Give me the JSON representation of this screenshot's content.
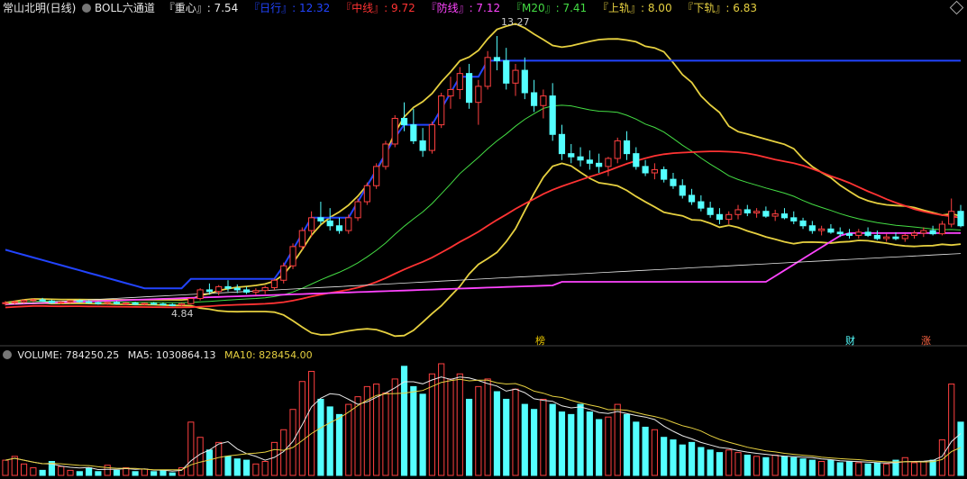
{
  "header": {
    "stock_title": "常山北明(日线)",
    "indicator": "BOLL六通道",
    "zhongxin": "『重心』: 7.54",
    "rixing": "『日行』: 12.32",
    "zhongxian": "『中线』: 9.72",
    "fangxian": "『防线』: 7.12",
    "m20": "『M20』: 7.41",
    "shanggui": "『上轨』: 8.00",
    "xiagui": "『下轨』: 6.83"
  },
  "markers": {
    "bang": "榜",
    "cai": "财",
    "zhang": "涨"
  },
  "volume_header": {
    "volume": "VOLUME: 784250.25",
    "ma5": "MA5: 1030864.13",
    "ma10": "MA10: 828454.00"
  },
  "colors": {
    "zhongxin": "#e8e8e8",
    "rixing": "#2244ff",
    "zhongxian": "#ff3333",
    "fangxian": "#ff44ff",
    "m20": "#44dd44",
    "shanggui": "#e6d040",
    "xiagui": "#e6d040",
    "up": "#ff4040",
    "down": "#54ffff"
  },
  "chart_data": {
    "type": "candlestick",
    "annotations": {
      "high_label": "13.27",
      "low_label": "4.84"
    },
    "candles": [
      [
        4.92,
        5.0,
        4.86,
        4.95
      ],
      [
        4.95,
        5.02,
        4.9,
        4.98
      ],
      [
        4.98,
        5.05,
        4.93,
        5.02
      ],
      [
        5.02,
        5.08,
        4.97,
        5.04
      ],
      [
        5.04,
        5.1,
        4.98,
        5.0
      ],
      [
        5.0,
        5.04,
        4.92,
        4.95
      ],
      [
        4.95,
        5.0,
        4.9,
        4.97
      ],
      [
        4.97,
        5.03,
        4.93,
        5.01
      ],
      [
        5.01,
        5.05,
        4.95,
        4.98
      ],
      [
        4.98,
        5.02,
        4.92,
        4.95
      ],
      [
        4.95,
        4.99,
        4.89,
        4.93
      ],
      [
        4.93,
        4.98,
        4.88,
        4.96
      ],
      [
        4.96,
        5.0,
        4.9,
        4.92
      ],
      [
        4.92,
        4.97,
        4.87,
        4.94
      ],
      [
        4.94,
        4.98,
        4.88,
        4.9
      ],
      [
        4.9,
        4.95,
        4.86,
        4.93
      ],
      [
        4.93,
        4.97,
        4.88,
        4.91
      ],
      [
        4.91,
        4.95,
        4.86,
        4.89
      ],
      [
        4.89,
        4.93,
        4.84,
        4.88
      ],
      [
        4.88,
        4.95,
        4.84,
        4.92
      ],
      [
        4.92,
        5.1,
        4.9,
        5.08
      ],
      [
        5.08,
        5.4,
        5.02,
        5.35
      ],
      [
        5.35,
        5.55,
        5.2,
        5.3
      ],
      [
        5.3,
        5.5,
        5.18,
        5.45
      ],
      [
        5.45,
        5.65,
        5.3,
        5.4
      ],
      [
        5.4,
        5.52,
        5.25,
        5.35
      ],
      [
        5.35,
        5.45,
        5.22,
        5.28
      ],
      [
        5.28,
        5.4,
        5.18,
        5.33
      ],
      [
        5.33,
        5.48,
        5.22,
        5.42
      ],
      [
        5.42,
        5.7,
        5.35,
        5.65
      ],
      [
        5.65,
        6.2,
        5.55,
        6.1
      ],
      [
        6.1,
        6.8,
        6.0,
        6.7
      ],
      [
        6.7,
        7.3,
        6.6,
        7.2
      ],
      [
        7.2,
        7.8,
        7.0,
        7.6
      ],
      [
        7.6,
        8.1,
        7.4,
        7.5
      ],
      [
        7.5,
        7.9,
        7.2,
        7.35
      ],
      [
        7.35,
        7.6,
        7.1,
        7.2
      ],
      [
        7.2,
        7.7,
        7.1,
        7.6
      ],
      [
        7.6,
        8.2,
        7.5,
        8.1
      ],
      [
        8.1,
        8.7,
        8.0,
        8.6
      ],
      [
        8.6,
        9.3,
        8.5,
        9.2
      ],
      [
        9.2,
        10.0,
        9.1,
        9.9
      ],
      [
        9.9,
        10.8,
        9.8,
        10.7
      ],
      [
        10.7,
        11.2,
        10.3,
        10.5
      ],
      [
        10.5,
        11.0,
        9.9,
        10.0
      ],
      [
        10.0,
        10.4,
        9.5,
        9.7
      ],
      [
        9.7,
        10.6,
        9.6,
        10.5
      ],
      [
        10.5,
        11.5,
        10.4,
        11.4
      ],
      [
        11.4,
        12.0,
        11.0,
        11.6
      ],
      [
        11.6,
        12.3,
        11.3,
        12.1
      ],
      [
        12.1,
        12.4,
        11.0,
        11.2
      ],
      [
        11.2,
        11.9,
        10.5,
        11.7
      ],
      [
        11.7,
        12.8,
        11.6,
        12.6
      ],
      [
        12.6,
        13.27,
        12.2,
        12.5
      ],
      [
        12.5,
        12.9,
        11.6,
        11.8
      ],
      [
        11.8,
        12.4,
        11.4,
        12.2
      ],
      [
        12.2,
        12.6,
        11.3,
        11.5
      ],
      [
        11.5,
        11.9,
        10.9,
        11.1
      ],
      [
        11.1,
        11.6,
        10.7,
        11.4
      ],
      [
        11.4,
        11.8,
        10.0,
        10.2
      ],
      [
        10.2,
        10.5,
        9.4,
        9.6
      ],
      [
        9.6,
        9.9,
        9.3,
        9.5
      ],
      [
        9.5,
        9.8,
        9.2,
        9.4
      ],
      [
        9.4,
        9.7,
        9.1,
        9.3
      ],
      [
        9.3,
        9.6,
        9.0,
        9.2
      ],
      [
        9.2,
        9.5,
        8.9,
        9.45
      ],
      [
        9.45,
        10.1,
        9.3,
        10.0
      ],
      [
        10.0,
        10.3,
        9.4,
        9.6
      ],
      [
        9.6,
        9.8,
        9.1,
        9.2
      ],
      [
        9.2,
        9.4,
        8.9,
        9.0
      ],
      [
        9.0,
        9.3,
        8.8,
        9.1
      ],
      [
        9.1,
        9.2,
        8.7,
        8.8
      ],
      [
        8.8,
        9.0,
        8.5,
        8.6
      ],
      [
        8.6,
        8.8,
        8.2,
        8.3
      ],
      [
        8.3,
        8.5,
        8.0,
        8.1
      ],
      [
        8.1,
        8.3,
        7.8,
        7.9
      ],
      [
        7.9,
        8.1,
        7.6,
        7.7
      ],
      [
        7.7,
        7.9,
        7.4,
        7.55
      ],
      [
        7.55,
        7.8,
        7.4,
        7.7
      ],
      [
        7.7,
        8.0,
        7.55,
        7.85
      ],
      [
        7.85,
        8.0,
        7.65,
        7.75
      ],
      [
        7.75,
        7.9,
        7.6,
        7.8
      ],
      [
        7.8,
        7.95,
        7.6,
        7.65
      ],
      [
        7.65,
        7.85,
        7.5,
        7.72
      ],
      [
        7.72,
        7.9,
        7.55,
        7.6
      ],
      [
        7.6,
        7.8,
        7.4,
        7.5
      ],
      [
        7.5,
        7.6,
        7.25,
        7.35
      ],
      [
        7.35,
        7.5,
        7.1,
        7.2
      ],
      [
        7.2,
        7.35,
        7.05,
        7.25
      ],
      [
        7.25,
        7.4,
        7.1,
        7.15
      ],
      [
        7.15,
        7.3,
        7.0,
        7.1
      ],
      [
        7.1,
        7.25,
        6.95,
        7.05
      ],
      [
        7.05,
        7.25,
        6.95,
        7.15
      ],
      [
        7.15,
        7.3,
        7.0,
        7.05
      ],
      [
        7.05,
        7.2,
        6.9,
        6.95
      ],
      [
        6.95,
        7.1,
        6.85,
        7.0
      ],
      [
        7.0,
        7.15,
        6.9,
        6.95
      ],
      [
        6.95,
        7.1,
        6.85,
        7.05
      ],
      [
        7.05,
        7.2,
        6.95,
        7.12
      ],
      [
        7.12,
        7.3,
        7.0,
        7.2
      ],
      [
        7.2,
        7.35,
        7.05,
        7.1
      ],
      [
        7.1,
        7.5,
        7.05,
        7.4
      ],
      [
        7.4,
        8.2,
        7.3,
        7.8
      ],
      [
        7.8,
        8.0,
        7.3,
        7.35
      ]
    ],
    "volume": [
      120,
      150,
      90,
      60,
      40,
      110,
      70,
      40,
      30,
      60,
      30,
      80,
      40,
      60,
      30,
      50,
      30,
      40,
      20,
      60,
      420,
      300,
      200,
      260,
      150,
      130,
      120,
      90,
      110,
      260,
      360,
      520,
      740,
      820,
      600,
      540,
      480,
      560,
      620,
      700,
      720,
      650,
      760,
      860,
      700,
      640,
      800,
      880,
      760,
      800,
      600,
      700,
      760,
      660,
      600,
      680,
      560,
      520,
      600,
      560,
      500,
      480,
      560,
      500,
      440,
      460,
      560,
      480,
      420,
      380,
      360,
      300,
      280,
      240,
      260,
      220,
      200,
      180,
      200,
      180,
      160,
      150,
      140,
      160,
      150,
      140,
      130,
      120,
      110,
      120,
      100,
      110,
      100,
      90,
      100,
      90,
      120,
      140,
      100,
      110,
      120,
      280,
      720,
      420
    ],
    "price_range": [
      4.0,
      14.0
    ],
    "series": [
      {
        "name": "重心"
      },
      {
        "name": "日行"
      },
      {
        "name": "中线"
      },
      {
        "name": "防线"
      },
      {
        "name": "M20"
      },
      {
        "name": "上轨"
      },
      {
        "name": "下轨"
      },
      {
        "name": "MA5"
      },
      {
        "name": "MA10"
      }
    ]
  }
}
